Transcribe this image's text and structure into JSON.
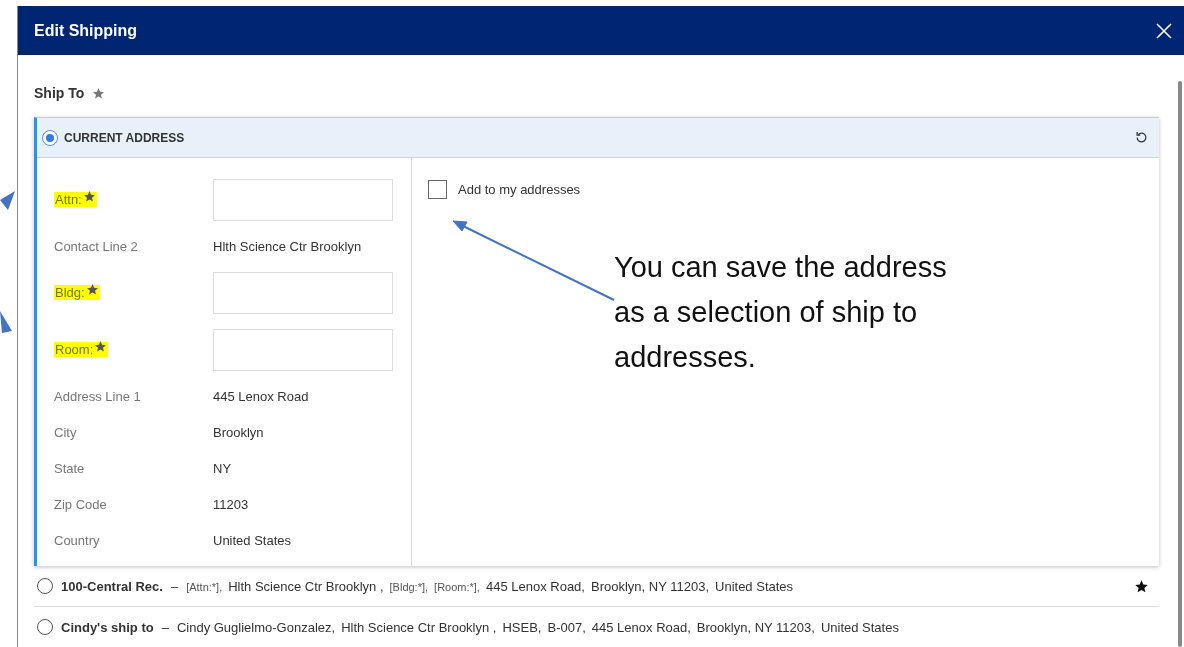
{
  "dialog": {
    "title": "Edit Shipping"
  },
  "ship_to": {
    "label": "Ship To",
    "required": true
  },
  "current_address": {
    "title": "CURRENT ADDRESS",
    "selected": true,
    "fields": [
      {
        "kind": "input",
        "label": "Attn:",
        "required": true,
        "highlighted": true
      },
      {
        "kind": "text",
        "label": "Contact Line 2",
        "value": "Hlth Science Ctr Brooklyn",
        "required": false,
        "highlighted": false
      },
      {
        "kind": "input",
        "label": "Bldg:",
        "required": true,
        "highlighted": true
      },
      {
        "kind": "input",
        "label": "Room:",
        "required": true,
        "highlighted": true
      },
      {
        "kind": "text",
        "label": "Address Line 1",
        "value": "445 Lenox Road",
        "required": false,
        "highlighted": false
      },
      {
        "kind": "text",
        "label": "City",
        "value": "Brooklyn",
        "required": false,
        "highlighted": false
      },
      {
        "kind": "text",
        "label": "State",
        "value": "NY",
        "required": false,
        "highlighted": false
      },
      {
        "kind": "text",
        "label": "Zip Code",
        "value": "11203",
        "required": false,
        "highlighted": false
      },
      {
        "kind": "text",
        "label": "Country",
        "value": "United States",
        "required": false,
        "highlighted": false
      }
    ],
    "add_to_addresses": {
      "label": "Add to my addresses",
      "checked": false
    }
  },
  "addresses": [
    {
      "name": "100-Central Rec.",
      "dash": "–",
      "selected": false,
      "favorite": true,
      "parts": [
        {
          "kind": "tag",
          "text": "[Attn:*],"
        },
        {
          "kind": "text",
          "text": "Hlth Science Ctr Brooklyn ,"
        },
        {
          "kind": "tag",
          "text": "[Bldg:*],"
        },
        {
          "kind": "tag",
          "text": "[Room:*],"
        },
        {
          "kind": "text",
          "text": "445 Lenox Road,"
        },
        {
          "kind": "text",
          "text": "Brooklyn, NY 11203,"
        },
        {
          "kind": "text",
          "text": "United States"
        }
      ]
    },
    {
      "name": "Cindy's ship to",
      "dash": "–",
      "selected": false,
      "favorite": false,
      "parts": [
        {
          "kind": "text",
          "text": "Cindy Guglielmo-Gonzalez,"
        },
        {
          "kind": "text",
          "text": "Hlth Science Ctr Brooklyn ,"
        },
        {
          "kind": "text",
          "text": "HSEB,"
        },
        {
          "kind": "text",
          "text": "B-007,"
        },
        {
          "kind": "text",
          "text": "445 Lenox Road,"
        },
        {
          "kind": "text",
          "text": "Brooklyn, NY 11203,"
        },
        {
          "kind": "text",
          "text": "United States"
        }
      ]
    }
  ],
  "annotation": {
    "text": "You can save the address as a selection of ship to addresses."
  }
}
